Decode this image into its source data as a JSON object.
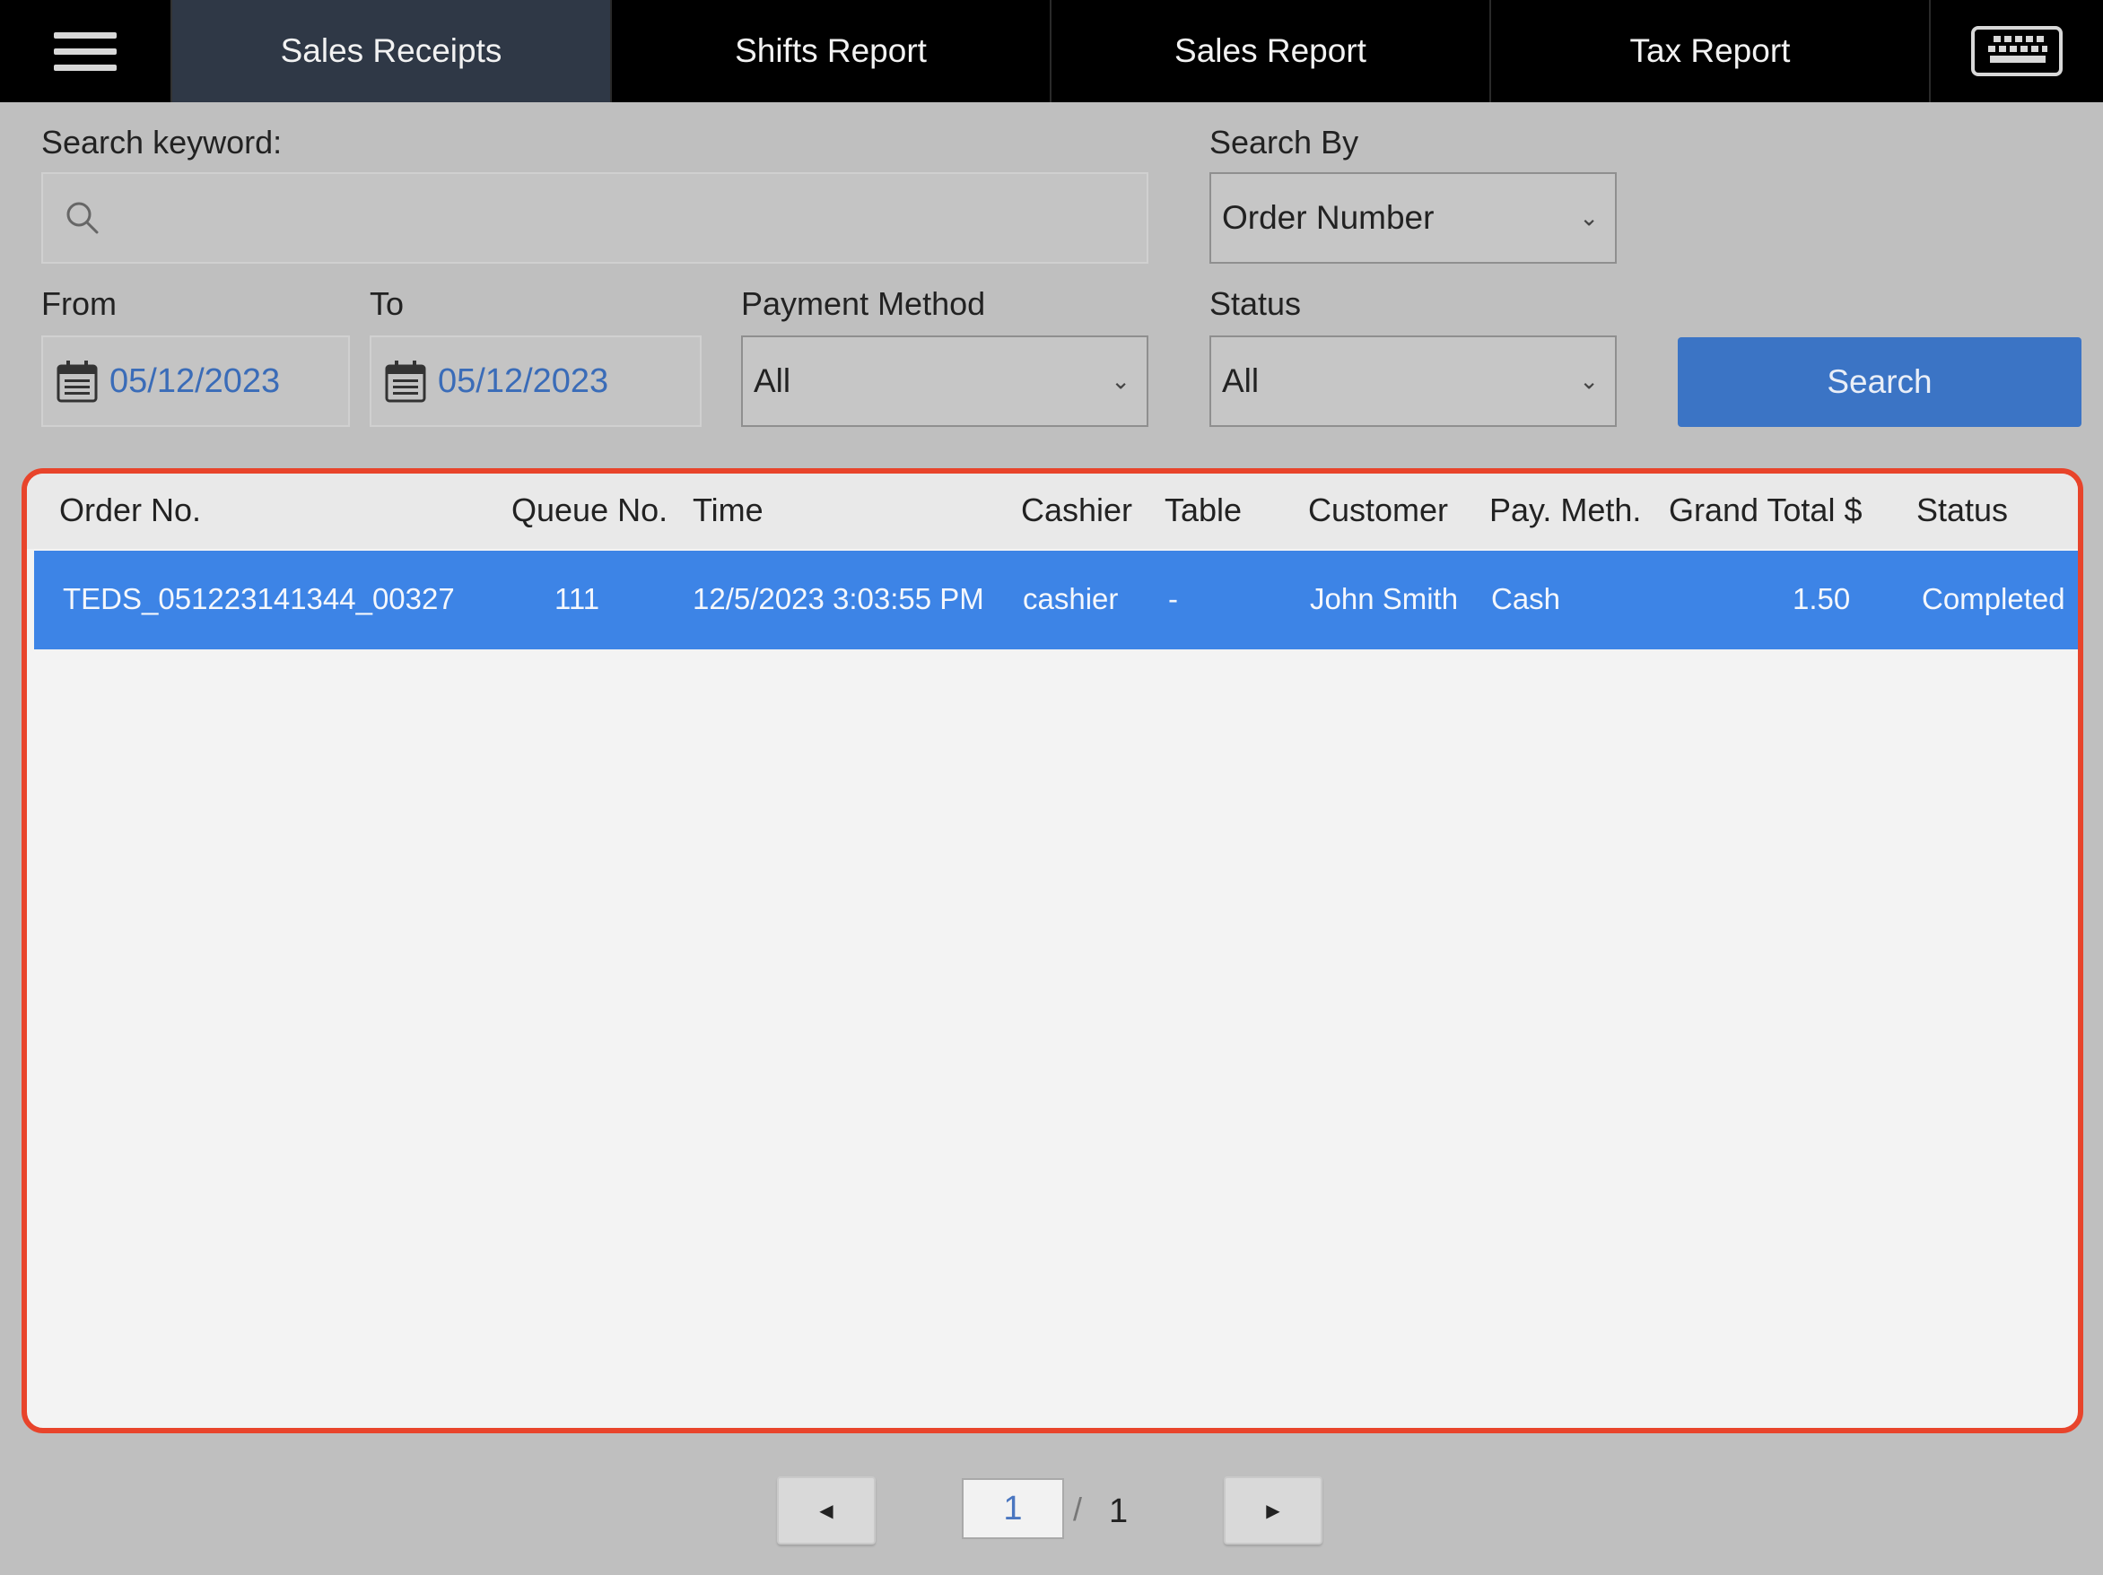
{
  "nav": {
    "menu_icon": "hamburger-icon",
    "tabs": [
      {
        "label": "Sales Receipts",
        "active": true
      },
      {
        "label": "Shifts Report",
        "active": false
      },
      {
        "label": "Sales Report",
        "active": false
      },
      {
        "label": "Tax Report",
        "active": false
      }
    ],
    "keyboard_icon": "keyboard-icon"
  },
  "form": {
    "keyword_label": "Search keyword:",
    "keyword_value": "",
    "search_by_label": "Search By",
    "search_by_value": "Order Number",
    "from_label": "From",
    "from_value": "05/12/2023",
    "to_label": "To",
    "to_value": "05/12/2023",
    "payment_label": "Payment Method",
    "payment_value": "All",
    "status_label": "Status",
    "status_value": "All",
    "search_button": "Search"
  },
  "table": {
    "headers": [
      "Order No.",
      "Queue No.",
      "Time",
      "Cashier",
      "Table",
      "Customer",
      "Pay. Meth.",
      "Grand Total $",
      "Status"
    ],
    "rows": [
      [
        "TEDS_051223141344_00327",
        "111",
        "12/5/2023 3:03:55 PM",
        "cashier",
        "-",
        "John Smith",
        "Cash",
        "1.50",
        "Completed"
      ]
    ]
  },
  "pagination": {
    "current": "1",
    "separator": "/",
    "total": "1"
  },
  "colors": {
    "accent": "#3b74c5",
    "selected_row": "#3d84e6",
    "highlight_border": "#e8442b",
    "nav_bg": "#000000",
    "nav_active": "#2f3846"
  }
}
